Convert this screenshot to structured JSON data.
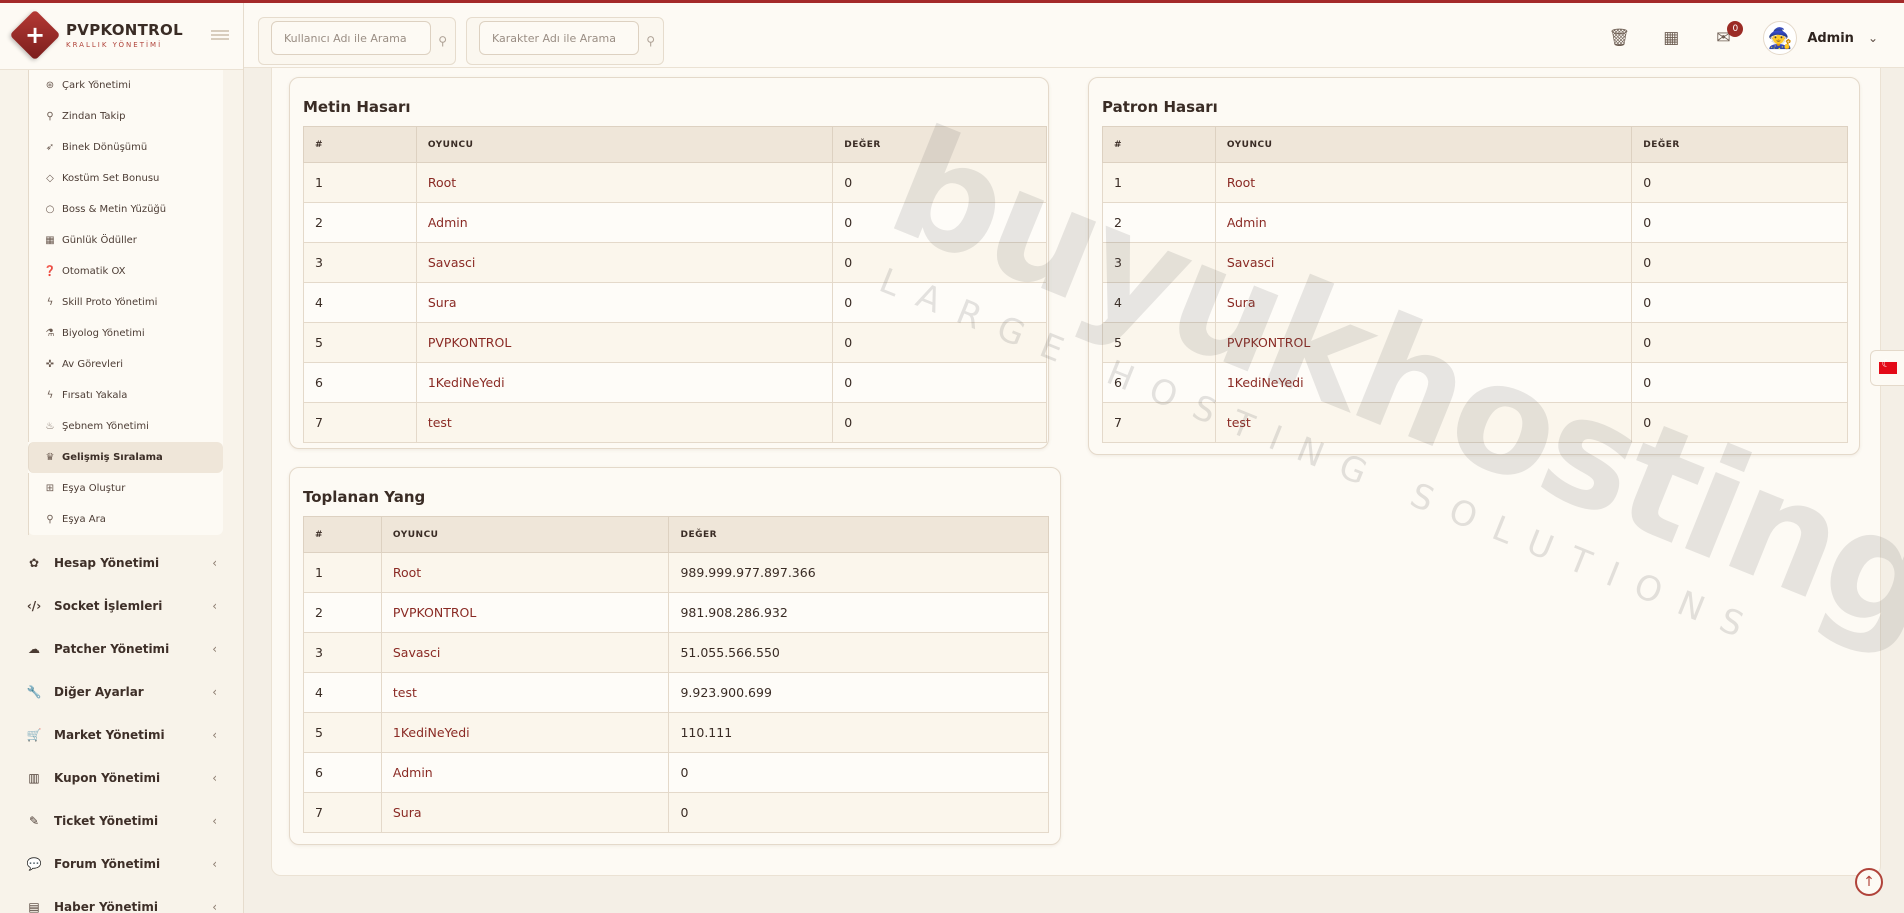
{
  "brand": {
    "title": "PVPKONTROL",
    "subtitle": "KRALLIK YÖNETİMİ"
  },
  "sidebar": {
    "submenu": [
      {
        "label": "Çark Yönetimi",
        "icon": "wheel-icon",
        "glyph": "⊛"
      },
      {
        "label": "Zindan Takip",
        "icon": "map-pin-icon",
        "glyph": "⚲"
      },
      {
        "label": "Binek Dönüşümü",
        "icon": "rocket-icon",
        "glyph": "➶"
      },
      {
        "label": "Kostüm Set Bonusu",
        "icon": "gem-icon",
        "glyph": "◇"
      },
      {
        "label": "Boss & Metin Yüzüğü",
        "icon": "ring-icon",
        "glyph": "○"
      },
      {
        "label": "Günlük Ödüller",
        "icon": "calendar-icon",
        "glyph": "▦"
      },
      {
        "label": "Otomatik OX",
        "icon": "question-icon",
        "glyph": "❓"
      },
      {
        "label": "Skill Proto Yönetimi",
        "icon": "bolt-icon",
        "glyph": "ϟ"
      },
      {
        "label": "Biyolog Yönetimi",
        "icon": "flask-icon",
        "glyph": "⚗"
      },
      {
        "label": "Av Görevleri",
        "icon": "crosshair-icon",
        "glyph": "✜"
      },
      {
        "label": "Fırsatı Yakala",
        "icon": "bolt-icon",
        "glyph": "ϟ"
      },
      {
        "label": "Şebnem Yönetimi",
        "icon": "fire-icon",
        "glyph": "♨"
      },
      {
        "label": "Gelişmiş Sıralama",
        "icon": "trophy-icon",
        "glyph": "♛",
        "active": true
      },
      {
        "label": "Eşya Oluştur",
        "icon": "gift-icon",
        "glyph": "⊞"
      },
      {
        "label": "Eşya Ara",
        "icon": "search-icon",
        "glyph": "⚲"
      }
    ],
    "menu": [
      {
        "label": "Hesap Yönetimi",
        "icon": "paw-icon",
        "glyph": "✿"
      },
      {
        "label": "Socket İşlemleri",
        "icon": "code-icon",
        "glyph": "‹/›"
      },
      {
        "label": "Patcher Yönetimi",
        "icon": "cloud-upload-icon",
        "glyph": "☁"
      },
      {
        "label": "Diğer Ayarlar",
        "icon": "wrench-icon",
        "glyph": "🔧"
      },
      {
        "label": "Market Yönetimi",
        "icon": "cart-icon",
        "glyph": "🛒"
      },
      {
        "label": "Kupon Yönetimi",
        "icon": "barcode-icon",
        "glyph": "▥"
      },
      {
        "label": "Ticket Yönetimi",
        "icon": "ticket-icon",
        "glyph": "✎"
      },
      {
        "label": "Forum Yönetimi",
        "icon": "comments-icon",
        "glyph": "💬"
      },
      {
        "label": "Haber Yönetimi",
        "icon": "newspaper-icon",
        "glyph": "▤"
      }
    ]
  },
  "header": {
    "search_user_placeholder": "Kullanıcı Adı ile Arama",
    "search_char_placeholder": "Karakter Adı ile Arama",
    "notifications_count": "0",
    "user_name": "Admin"
  },
  "tables": {
    "metin": {
      "title": "Metin Hasarı",
      "columns": [
        "#",
        "OYUNCU",
        "DEĞER"
      ],
      "rows": [
        [
          "1",
          "Root",
          "0"
        ],
        [
          "2",
          "Admin",
          "0"
        ],
        [
          "3",
          "Savasci",
          "0"
        ],
        [
          "4",
          "Sura",
          "0"
        ],
        [
          "5",
          "PVPKONTROL",
          "0"
        ],
        [
          "6",
          "1KediNeYedi",
          "0"
        ],
        [
          "7",
          "test",
          "0"
        ]
      ]
    },
    "patron": {
      "title": "Patron Hasarı",
      "columns": [
        "#",
        "OYUNCU",
        "DEĞER"
      ],
      "rows": [
        [
          "1",
          "Root",
          "0"
        ],
        [
          "2",
          "Admin",
          "0"
        ],
        [
          "3",
          "Savasci",
          "0"
        ],
        [
          "4",
          "Sura",
          "0"
        ],
        [
          "5",
          "PVPKONTROL",
          "0"
        ],
        [
          "6",
          "1KediNeYedi",
          "0"
        ],
        [
          "7",
          "test",
          "0"
        ]
      ]
    },
    "yang": {
      "title": "Toplanan Yang",
      "columns": [
        "#",
        "OYUNCU",
        "DEĞER"
      ],
      "rows": [
        [
          "1",
          "Root",
          "989.999.977.897.366"
        ],
        [
          "2",
          "PVPKONTROL",
          "981.908.286.932"
        ],
        [
          "3",
          "Savasci",
          "51.055.566.550"
        ],
        [
          "4",
          "test",
          "9.923.900.699"
        ],
        [
          "5",
          "1KediNeYedi",
          "110.111"
        ],
        [
          "6",
          "Admin",
          "0"
        ],
        [
          "7",
          "Sura",
          "0"
        ]
      ]
    }
  },
  "watermark": {
    "main": "buyukhosting",
    "sub": "LARGE HOSTING SOLUTIONS"
  },
  "colors": {
    "accent": "#a42a2a",
    "player_text": "#8a2a24",
    "table_header": "#efe6d9"
  }
}
